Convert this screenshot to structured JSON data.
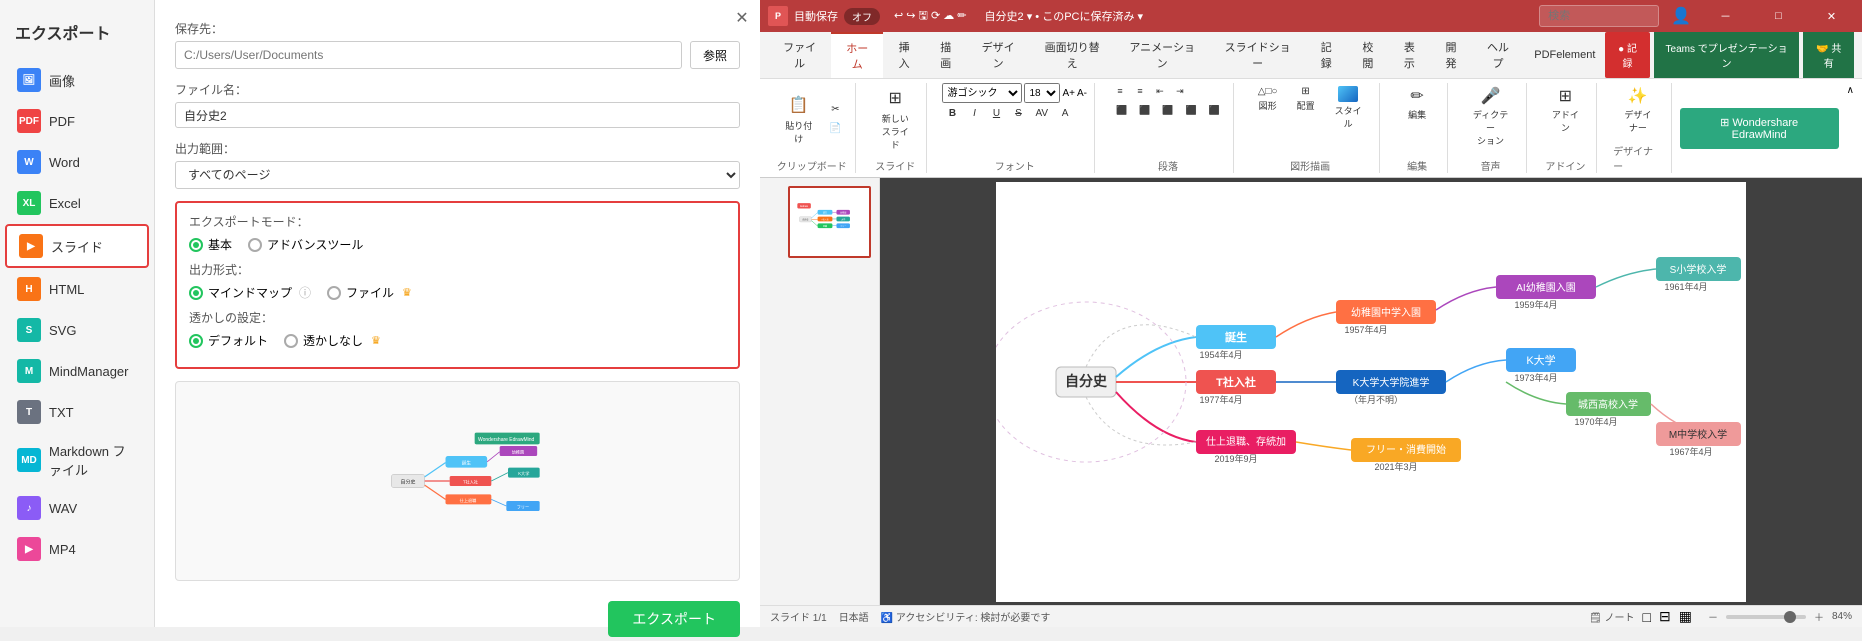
{
  "app": {
    "title": "エクスポート"
  },
  "sidebar": {
    "items": [
      {
        "id": "image",
        "label": "画像",
        "icon": "IMG",
        "color": "blue"
      },
      {
        "id": "pdf",
        "label": "PDF",
        "icon": "PDF",
        "color": "red"
      },
      {
        "id": "word",
        "label": "Word",
        "icon": "W",
        "color": "blue"
      },
      {
        "id": "excel",
        "label": "Excel",
        "icon": "XL",
        "color": "green"
      },
      {
        "id": "slide",
        "label": "スライド",
        "icon": "▶",
        "color": "orange",
        "active": true
      },
      {
        "id": "html",
        "label": "HTML",
        "icon": "H",
        "color": "orange"
      },
      {
        "id": "svg",
        "label": "SVG",
        "icon": "S",
        "color": "teal"
      },
      {
        "id": "mindmanager",
        "label": "MindManager",
        "icon": "M",
        "color": "teal"
      },
      {
        "id": "txt",
        "label": "TXT",
        "icon": "T",
        "color": "gray"
      },
      {
        "id": "markdown",
        "label": "Markdown ファイル",
        "icon": "MD",
        "color": "cyan"
      },
      {
        "id": "wav",
        "label": "WAV",
        "icon": "W",
        "color": "purple"
      },
      {
        "id": "mp4",
        "label": "MP4",
        "icon": "▶",
        "color": "pink"
      }
    ]
  },
  "form": {
    "save_location_label": "保存先：",
    "save_location_placeholder": "C:/Users/User/Documents",
    "browse_btn": "参照",
    "filename_label": "ファイル名：",
    "filename_value": "自分史2",
    "output_range_label": "出力範囲：",
    "output_range_value": "すべてのページ",
    "export_mode_label": "エクスポートモード：",
    "mode_basic": "基本",
    "mode_advanced": "アドバンスツール",
    "output_format_label": "出力形式：",
    "format_mindmap": "マインドマップ",
    "format_mindmap_info": "ⓘ",
    "format_file": "ファイル",
    "watermark_label": "透かしの設定：",
    "watermark_default": "デフォルト",
    "watermark_none": "透かしなし",
    "export_btn": "エクスポート",
    "crown_icon": "♛"
  },
  "ppt": {
    "title_bar": {
      "autosave_label": "目動保存",
      "autosave_state": "オフ",
      "filename": "自分史2",
      "save_location": "このPCに保存済み",
      "search_placeholder": "検索",
      "user_icon": "👤",
      "minimize": "－",
      "maximize": "□",
      "close": "✕"
    },
    "ribbon": {
      "tabs": [
        "ファイル",
        "ホーム",
        "挿入",
        "描画",
        "デザイン",
        "画面切り替え",
        "アニメーション",
        "スライドショー",
        "記録",
        "校閲",
        "表示",
        "開発",
        "ヘルプ",
        "PDFelement"
      ],
      "active_tab": "ホーム",
      "extra_btns": [
        "記録",
        "Teamsでプレゼンテーション",
        "共有"
      ],
      "groups": [
        {
          "label": "クリップボード",
          "btns": [
            "貼り付け"
          ]
        },
        {
          "label": "スライド",
          "btns": [
            "新しいスライド"
          ]
        },
        {
          "label": "フォント",
          "btns": [
            "B",
            "I",
            "U",
            "S"
          ]
        },
        {
          "label": "段落",
          "btns": [
            "≡",
            "≡",
            "≡"
          ]
        },
        {
          "label": "図形描画",
          "btns": [
            "図形",
            "配置"
          ]
        },
        {
          "label": "編集",
          "btns": [
            "編集"
          ]
        },
        {
          "label": "音声",
          "btns": [
            "ディクテーション"
          ]
        },
        {
          "label": "アドイン",
          "btns": [
            "アドイン"
          ]
        },
        {
          "label": "デザイナー",
          "btns": [
            "デザイナー"
          ]
        }
      ]
    },
    "slide": {
      "number": "1",
      "slide_count": "スライド 1/1",
      "language": "日本語",
      "accessibility": "♿ アクセシビリティ: 検討が必要です"
    },
    "status_bar": {
      "slide_info": "スライド 1/1",
      "language": "日本語",
      "accessibility": "♿ アクセシビリティ: 検討が必要です",
      "notes_btn": "🗒 ノート",
      "zoom": "84%",
      "view_btns": [
        "□",
        "⊟",
        "▦"
      ]
    },
    "wondershare": {
      "label": "Wondershare EdrawMind"
    }
  }
}
